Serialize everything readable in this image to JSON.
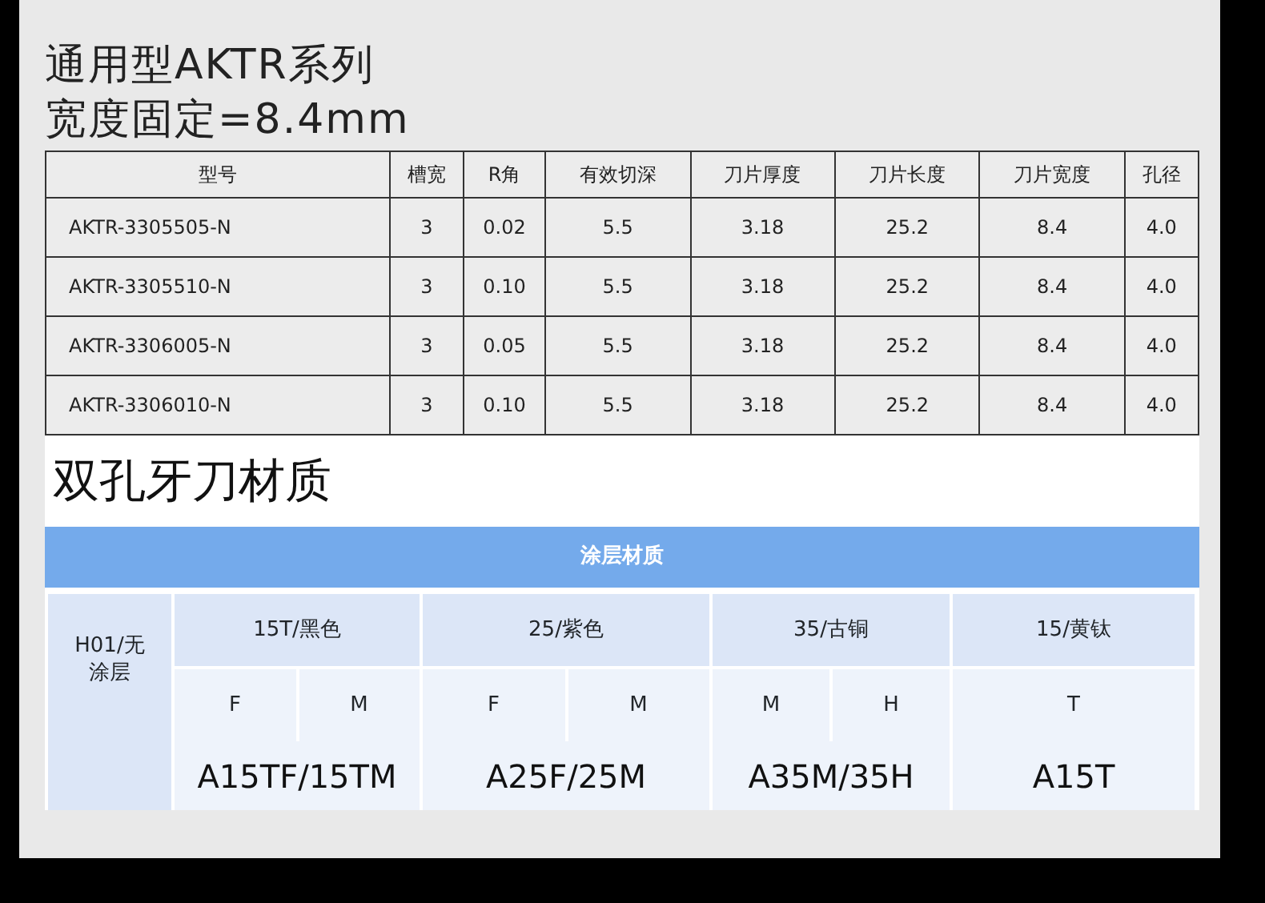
{
  "heading_lines": [
    "通用型AKTR系列",
    "宽度固定=8.4mm"
  ],
  "spec_table": {
    "columns": [
      "型号",
      "槽宽",
      "R角",
      "有效切深",
      "刀片厚度",
      "刀片长度",
      "刀片宽度",
      "孔径"
    ],
    "rows": [
      [
        "AKTR-3305505-N",
        "3",
        "0.02",
        "5.5",
        "3.18",
        "25.2",
        "8.4",
        "4.0"
      ],
      [
        "AKTR-3305510-N",
        "3",
        "0.10",
        "5.5",
        "3.18",
        "25.2",
        "8.4",
        "4.0"
      ],
      [
        "AKTR-3306005-N",
        "3",
        "0.05",
        "5.5",
        "3.18",
        "25.2",
        "8.4",
        "4.0"
      ],
      [
        "AKTR-3306010-N",
        "3",
        "0.10",
        "5.5",
        "3.18",
        "25.2",
        "8.4",
        "4.0"
      ]
    ]
  },
  "section_title": "双孔牙刀材质",
  "coating_table": {
    "banner": "涂层材质",
    "row_header": "H01/无涂层",
    "groups": [
      {
        "label": "15T/黑色",
        "grades": [
          "F",
          "M"
        ],
        "product": "A15TF/15TM"
      },
      {
        "label": "25/紫色",
        "grades": [
          "F",
          "M"
        ],
        "product": "A25F/25M"
      },
      {
        "label": "35/古铜",
        "grades": [
          "M",
          "H"
        ],
        "product": "A35M/35H"
      },
      {
        "label": "15/黄钛",
        "grades": [
          "T"
        ],
        "product": "A15T"
      }
    ]
  }
}
